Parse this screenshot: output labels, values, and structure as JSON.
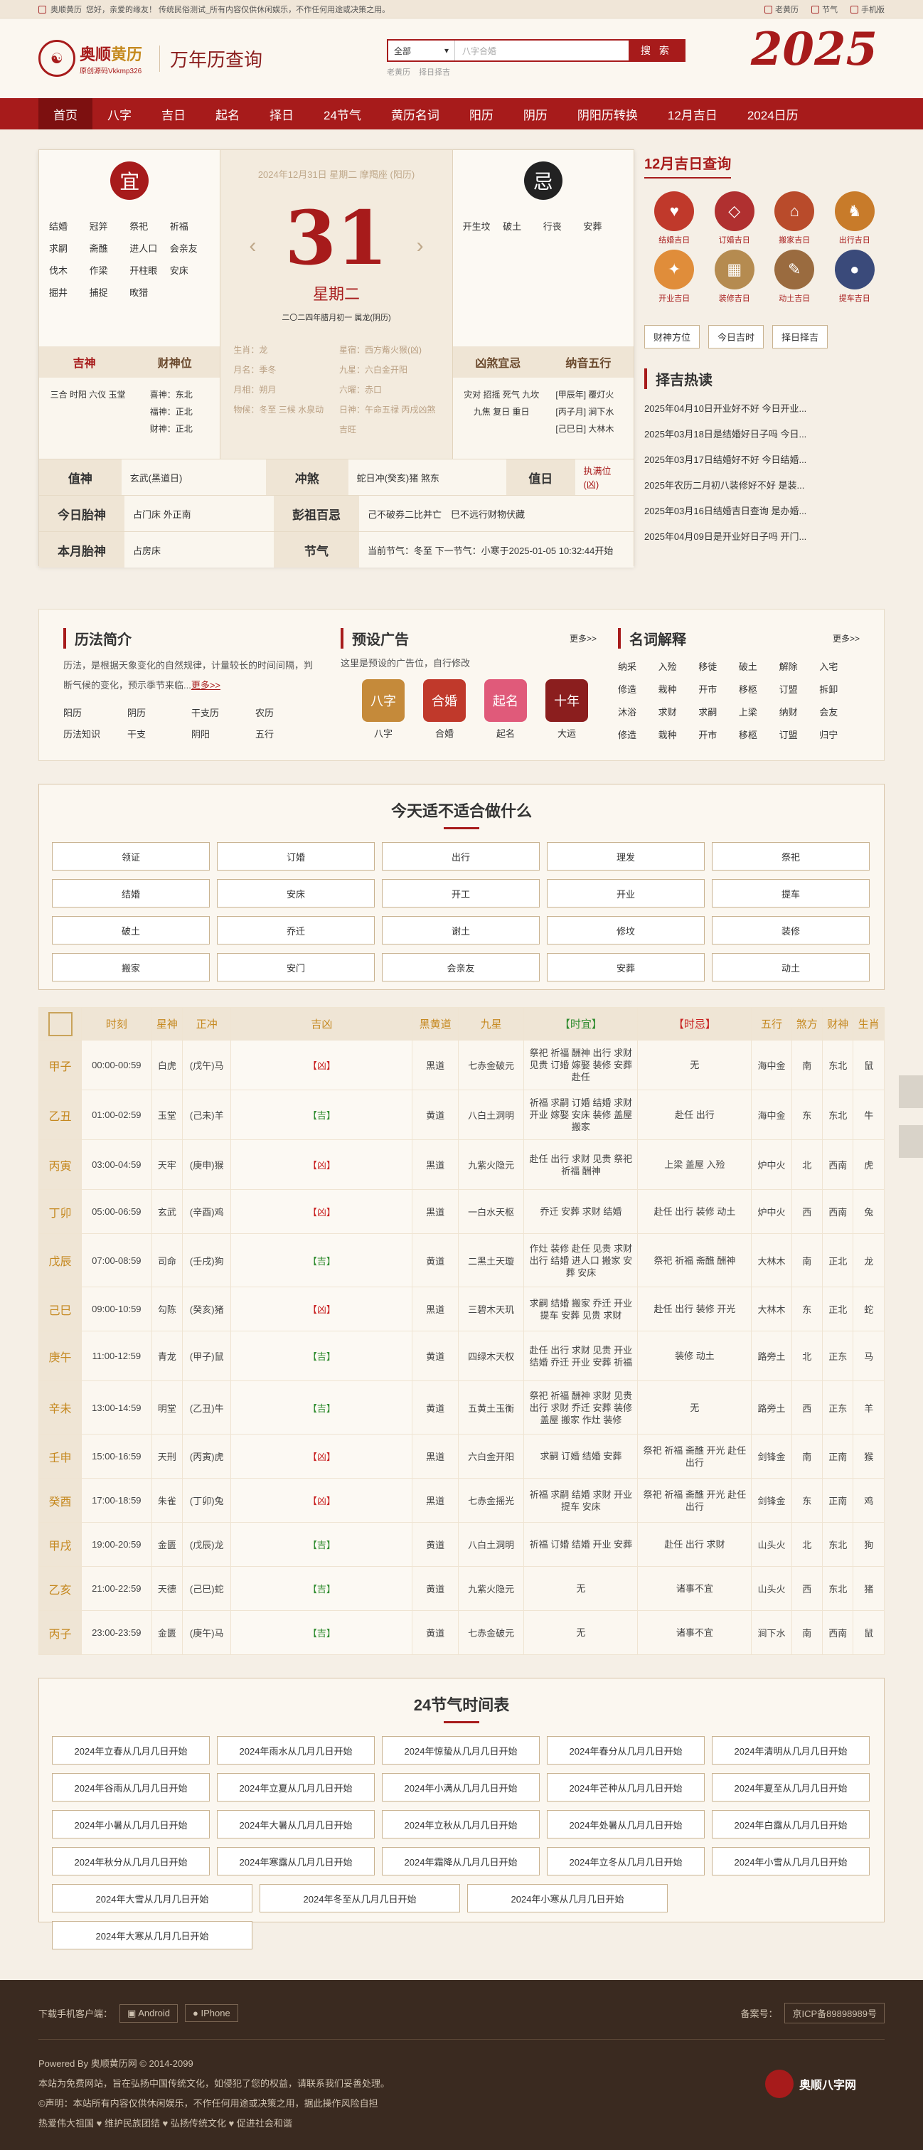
{
  "topbar": {
    "home": "奥顺黄历",
    "notice": "您好，亲爱的缘友！ 传统民俗测试_所有内容仅供休闲娱乐，不作任何用途或决策之用。",
    "links": [
      "老黄历",
      "节气",
      "手机版"
    ]
  },
  "header": {
    "logo_name": "奥顺",
    "logo_name_b": "黄历",
    "logo_sub": "原创源码Vkkmp326",
    "title": "万年历查询",
    "search_select": "全部",
    "search_placeholder": "八字合婚",
    "search_btn": "搜 索",
    "hot": [
      "老黄历",
      "择日择吉"
    ],
    "year": "2025"
  },
  "nav": [
    "首页",
    "八字",
    "吉日",
    "起名",
    "择日",
    "24节气",
    "黄历名词",
    "阳历",
    "阴历",
    "阴阳历转换",
    "12月吉日",
    "2024日历"
  ],
  "calendar": {
    "yi_char": "宜",
    "ji_char": "忌",
    "yi_words": [
      "结婚",
      "冠笄",
      "祭祀",
      "祈福",
      "求嗣",
      "斋醮",
      "进人口",
      "会亲友",
      "伐木",
      "作梁",
      "开柱眼",
      "安床",
      "掘井",
      "捕捉",
      "畋猎"
    ],
    "ji_words": [
      "开生坟",
      "破土",
      "行丧",
      "安葬"
    ],
    "date_line": "2024年12月31日 星期二 摩羯座 (阳历)",
    "day": "31",
    "weekday": "星期二",
    "lunar": "二〇二四年腊月初一 属龙(阴历)",
    "mid_info": [
      "生肖：龙",
      "星宿：西方觜火猴(凶)",
      "月名：季冬",
      "九星：六白金开阳",
      "月相：朔月",
      "六曜：赤口",
      "物候：冬至 三候 水泉动",
      "日神：午命五禄 丙戌凶煞 吉旺"
    ],
    "jishen_h": "吉神",
    "caishen_h": "财神位",
    "jishen": "三合 时阳 六仪 玉堂",
    "caishen": [
      "喜神：东北",
      "福神：正北",
      "财神：正北"
    ],
    "xiongsha_h": "凶煞宜忌",
    "nayin_h": "纳音五行",
    "xiongsha": "灾对 招摇 死气 九坎 九焦 复日 重日",
    "nayin": [
      "[甲辰年] 覆灯火",
      "[丙子月] 涧下水",
      "[己巳日] 大林木"
    ],
    "rows": [
      {
        "h": "值神",
        "v": "玄武(黑道日)",
        "h2": "冲煞",
        "v2": "蛇日冲(癸亥)猪 煞东",
        "h3": "值日",
        "v3": "执满位(凶)"
      },
      {
        "h": "今日胎神",
        "v": "占门床 外正南",
        "h2": "彭祖百忌",
        "v2": "己不破券二比并亡　巳不远行财物伏藏"
      },
      {
        "h": "本月胎神",
        "v": "占房床",
        "h2": "节气",
        "v2": "当前节气：冬至 下一节气：小寒于2025-01-05 10:32:44开始"
      }
    ]
  },
  "side": {
    "title": "12月吉日查询",
    "jiri": [
      "结婚吉日",
      "订婚吉日",
      "搬家吉日",
      "出行吉日",
      "开业吉日",
      "装修吉日",
      "动土吉日",
      "提车吉日"
    ],
    "buttons": [
      "财神方位",
      "今日吉时",
      "择日择吉"
    ],
    "hot_title": "择吉热读",
    "hot": [
      "2025年04月10日开业好不好 今日开业...",
      "2025年03月18日是结婚好日子吗 今日...",
      "2025年03月17日结婚好不好 今日结婚...",
      "2025年农历二月初八装修好不好 是装...",
      "2025年03月16日结婚吉日查询 是办婚...",
      "2025年04月09日是开业好日子吗 开门..."
    ]
  },
  "info": {
    "intro_title": "历法简介",
    "intro_text": "历法，是根据天象变化的自然规律，计量较长的时间间隔，判断气候的变化，预示季节来临...",
    "intro_more": "更多>>",
    "intro_links": [
      "阳历",
      "阴历",
      "干支历",
      "农历",
      "历法知识",
      "干支",
      "阴阳",
      "五行"
    ],
    "ad_title": "预设广告",
    "ad_more": "更多>>",
    "ad_text": "这里是预设的广告位，自行修改",
    "ads": [
      "八字",
      "合婚",
      "起名",
      "大运"
    ],
    "ad_icons": [
      "八字",
      "合婚",
      "起名",
      "十年"
    ],
    "terms_title": "名词解释",
    "terms_more": "更多>>",
    "terms": [
      "纳采",
      "入殓",
      "移徙",
      "破土",
      "解除",
      "入宅",
      "修造",
      "栽种",
      "开市",
      "移柩",
      "订盟",
      "拆卸",
      "沐浴",
      "求财",
      "求嗣",
      "上梁",
      "纳财",
      "会友",
      "修造",
      "栽种",
      "开市",
      "移柩",
      "订盟",
      "归宁"
    ]
  },
  "suit": {
    "title": "今天适不适合做什么",
    "items": [
      "领证",
      "订婚",
      "出行",
      "理发",
      "祭祀",
      "结婚",
      "安床",
      "开工",
      "开业",
      "提车",
      "破土",
      "乔迁",
      "谢土",
      "修坟",
      "装修",
      "搬家",
      "安门",
      "会亲友",
      "安葬",
      "动土"
    ]
  },
  "table": {
    "headers": [
      "时刻",
      "星神",
      "正冲",
      "吉凶",
      "黑黄道",
      "九星",
      "【时宜】",
      "【时忌】",
      "五行",
      "煞方",
      "财神",
      "生肖"
    ],
    "rows": [
      [
        "甲子",
        "00:00-00:59",
        "白虎",
        "(戊午)马",
        "【凶】",
        "黑道",
        "七赤金破元",
        "祭祀 祈福 酬神 出行 求财 见贵 订婚 嫁娶 装修 安葬 赴任",
        "无",
        "海中金",
        "南",
        "东北",
        "鼠"
      ],
      [
        "乙丑",
        "01:00-02:59",
        "玉堂",
        "(己未)羊",
        "【吉】",
        "黄道",
        "八白土洞明",
        "祈福 求嗣 订婚 结婚 求财 开业 嫁娶 安床 装修 盖屋 搬家",
        "赴任 出行",
        "海中金",
        "东",
        "东北",
        "牛"
      ],
      [
        "丙寅",
        "03:00-04:59",
        "天牢",
        "(庚申)猴",
        "【凶】",
        "黑道",
        "九紫火隐元",
        "赴任 出行 求财 见贵 祭祀 祈福 酬神",
        "上梁 盖屋 入殓",
        "炉中火",
        "北",
        "西南",
        "虎"
      ],
      [
        "丁卯",
        "05:00-06:59",
        "玄武",
        "(辛酉)鸡",
        "【凶】",
        "黑道",
        "一白水天枢",
        "乔迁 安葬 求财 结婚",
        "赴任 出行 装修 动土",
        "炉中火",
        "西",
        "西南",
        "兔"
      ],
      [
        "戊辰",
        "07:00-08:59",
        "司命",
        "(壬戌)狗",
        "【吉】",
        "黄道",
        "二黑土天璇",
        "作灶 装修 赴任 见贵 求财 出行 结婚 进人口 搬家 安葬 安床",
        "祭祀 祈福 斋醮 酬神",
        "大林木",
        "南",
        "正北",
        "龙"
      ],
      [
        "己巳",
        "09:00-10:59",
        "勾陈",
        "(癸亥)猪",
        "【凶】",
        "黑道",
        "三碧木天玑",
        "求嗣 结婚 搬家 乔迁 开业 提车 安葬 见贵 求财",
        "赴任 出行 装修 开光",
        "大林木",
        "东",
        "正北",
        "蛇"
      ],
      [
        "庚午",
        "11:00-12:59",
        "青龙",
        "(甲子)鼠",
        "【吉】",
        "黄道",
        "四绿木天权",
        "赴任 出行 求财 见贵 开业 结婚 乔迁 开业 安葬 祈福",
        "装修 动土",
        "路旁土",
        "北",
        "正东",
        "马"
      ],
      [
        "辛未",
        "13:00-14:59",
        "明堂",
        "(乙丑)牛",
        "【吉】",
        "黄道",
        "五黄土玉衡",
        "祭祀 祈福 酬神 求财 见贵 出行 求财 乔迁 安葬 装修 盖屋 搬家 作灶 装修",
        "无",
        "路旁土",
        "西",
        "正东",
        "羊"
      ],
      [
        "壬申",
        "15:00-16:59",
        "天刑",
        "(丙寅)虎",
        "【凶】",
        "黑道",
        "六白金开阳",
        "求嗣 订婚 结婚 安葬",
        "祭祀 祈福 斋醮 开光 赴任 出行",
        "剑锋金",
        "南",
        "正南",
        "猴"
      ],
      [
        "癸酉",
        "17:00-18:59",
        "朱雀",
        "(丁卯)兔",
        "【凶】",
        "黑道",
        "七赤金摇光",
        "祈福 求嗣 结婚 求财 开业 提车 安床",
        "祭祀 祈福 斋醮 开光 赴任 出行",
        "剑锋金",
        "东",
        "正南",
        "鸡"
      ],
      [
        "甲戌",
        "19:00-20:59",
        "金匮",
        "(戊辰)龙",
        "【吉】",
        "黄道",
        "八白土洞明",
        "祈福 订婚 结婚 开业 安葬",
        "赴任 出行 求财",
        "山头火",
        "北",
        "东北",
        "狗"
      ],
      [
        "乙亥",
        "21:00-22:59",
        "天德",
        "(己巳)蛇",
        "【吉】",
        "黄道",
        "九紫火隐元",
        "无",
        "诸事不宜",
        "山头火",
        "西",
        "东北",
        "猪"
      ],
      [
        "丙子",
        "23:00-23:59",
        "金匮",
        "(庚午)马",
        "【吉】",
        "黄道",
        "七赤金破元",
        "无",
        "诸事不宜",
        "涧下水",
        "南",
        "西南",
        "鼠"
      ]
    ]
  },
  "jieqi": {
    "title": "24节气时间表",
    "items": [
      "2024年立春从几月几日开始",
      "2024年雨水从几月几日开始",
      "2024年惊蛰从几月几日开始",
      "2024年春分从几月几日开始",
      "2024年清明从几月几日开始",
      "2024年谷雨从几月几日开始",
      "2024年立夏从几月几日开始",
      "2024年小满从几月几日开始",
      "2024年芒种从几月几日开始",
      "2024年夏至从几月几日开始",
      "2024年小暑从几月几日开始",
      "2024年大暑从几月几日开始",
      "2024年立秋从几月几日开始",
      "2024年处暑从几月几日开始",
      "2024年白露从几月几日开始",
      "2024年秋分从几月几日开始",
      "2024年寒露从几月几日开始",
      "2024年霜降从几月几日开始",
      "2024年立冬从几月几日开始",
      "2024年小雪从几月几日开始"
    ],
    "items_wide": [
      "2024年大雪从几月几日开始",
      "2024年冬至从几月几日开始",
      "2024年小寒从几月几日开始",
      "2024年大寒从几月几日开始"
    ]
  },
  "footer": {
    "dl_label": "下载手机客户端：",
    "android": "Android",
    "iphone": "IPhone",
    "icp_label": "备案号：",
    "icp": "京ICP备89898989号",
    "lines": [
      "Powered By 奥顺黄历网 © 2014-2099",
      "本站为免费网站，旨在弘扬中国传统文化，如侵犯了您的权益，请联系我们妥善处理。",
      "©声明：本站所有内容仅供休闲娱乐，不作任何用途或决策之用，据此操作风险自担",
      "热爱伟大祖国 ♥ 维护民族团结 ♥ 弘扬传统文化 ♥ 促进社会和谐"
    ],
    "logo": "奥顺八字网"
  }
}
